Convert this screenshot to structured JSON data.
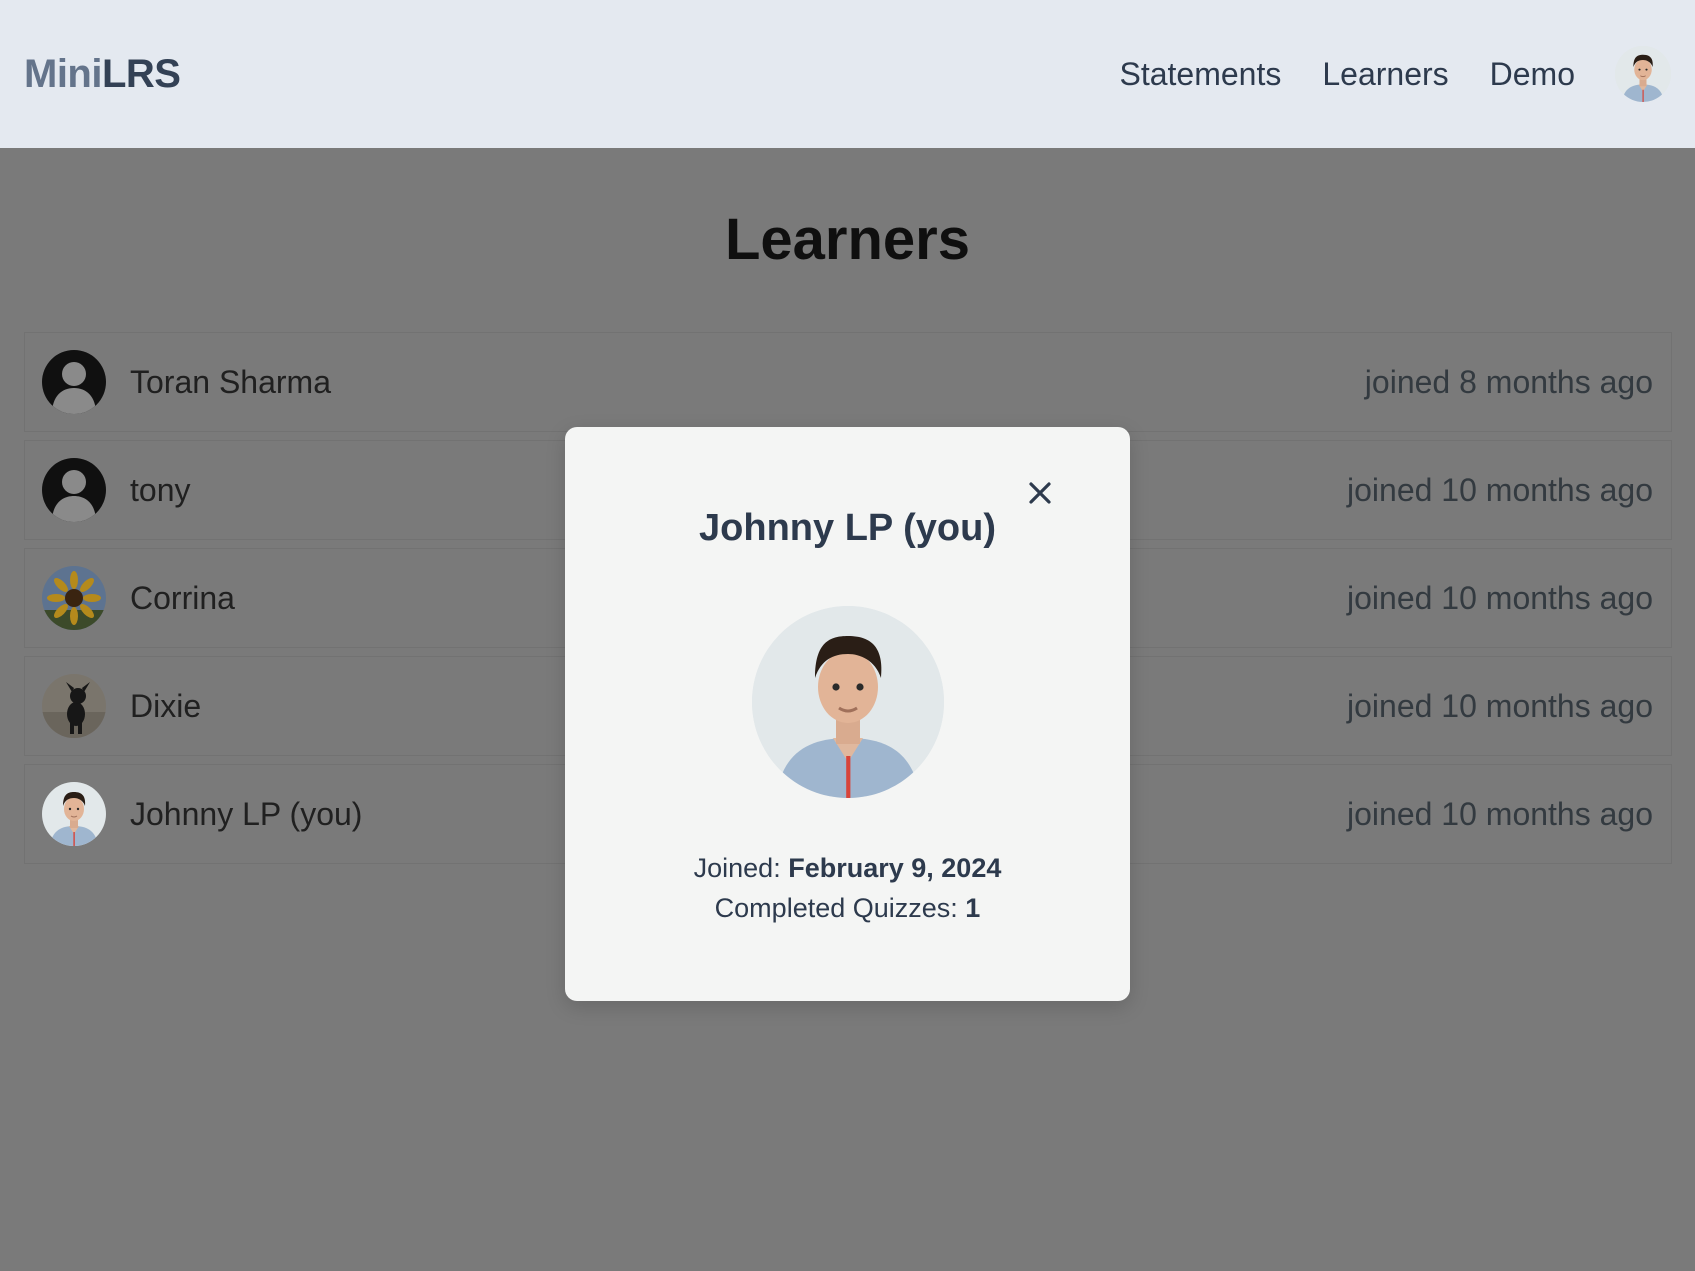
{
  "nav": {
    "brand_part1": "Mini",
    "brand_part2": "LRS",
    "links": [
      "Statements",
      "Learners",
      "Demo"
    ]
  },
  "page": {
    "title": "Learners"
  },
  "learners": [
    {
      "name": "Toran Sharma",
      "joined": "joined 8 months ago",
      "avatar": "default-user-icon"
    },
    {
      "name": "tony",
      "joined": "joined 10 months ago",
      "avatar": "default-user-icon"
    },
    {
      "name": "Corrina",
      "joined": "joined 10 months ago",
      "avatar": "sunflower-photo"
    },
    {
      "name": "Dixie",
      "joined": "joined 10 months ago",
      "avatar": "dog-photo"
    },
    {
      "name": "Johnny LP (you)",
      "joined": "joined 10 months ago",
      "avatar": "man-photo"
    }
  ],
  "modal": {
    "title": "Johnny LP (you)",
    "close_glyph": "×",
    "joined_label": "Joined:",
    "joined_value": "February 9, 2024",
    "quizzes_label": "Completed Quizzes:",
    "quizzes_value": "1"
  },
  "colors": {
    "navbar_bg": "#e4e9f0",
    "overlay": "#7a7a7a",
    "modal_bg": "#f4f5f4",
    "text_dark": "#2d3a4d"
  }
}
